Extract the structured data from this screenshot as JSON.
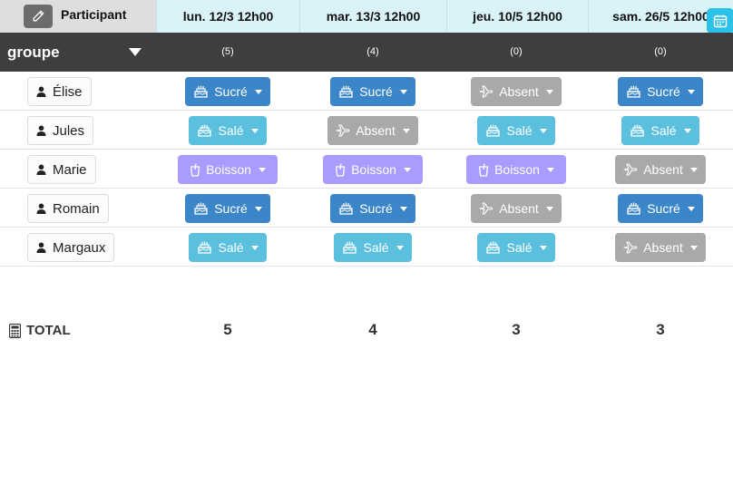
{
  "header": {
    "participant_label": "Participant",
    "dates": [
      "lun. 12/3 12h00",
      "mar. 13/3 12h00",
      "jeu. 10/5 12h00",
      "sam. 26/5 12h00"
    ],
    "edit_icon": "pencil-icon",
    "calendar_icon": "calendar-icon"
  },
  "group": {
    "label": "groupe",
    "counts": [
      "(5)",
      "(4)",
      "(0)",
      "(0)"
    ]
  },
  "rows": [
    {
      "name": "Élise",
      "choices": [
        "Sucré",
        "Sucré",
        "Absent",
        "Sucré"
      ]
    },
    {
      "name": "Jules",
      "choices": [
        "Salé",
        "Absent",
        "Salé",
        "Salé"
      ]
    },
    {
      "name": "Marie",
      "choices": [
        "Boisson",
        "Boisson",
        "Boisson",
        "Absent"
      ]
    },
    {
      "name": "Romain",
      "choices": [
        "Sucré",
        "Sucré",
        "Absent",
        "Sucré"
      ]
    },
    {
      "name": "Margaux",
      "choices": [
        "Salé",
        "Salé",
        "Salé",
        "Absent"
      ]
    }
  ],
  "total": {
    "label": "TOTAL",
    "values": [
      "5",
      "4",
      "3",
      "3"
    ]
  },
  "colors": {
    "sucre": "#3a86c8",
    "sale": "#5bc0de",
    "absent": "#a9a9a9",
    "boisson": "#a89cff",
    "header_date_bg": "#d9f3f9",
    "group_bar_bg": "#3e3e3e"
  }
}
